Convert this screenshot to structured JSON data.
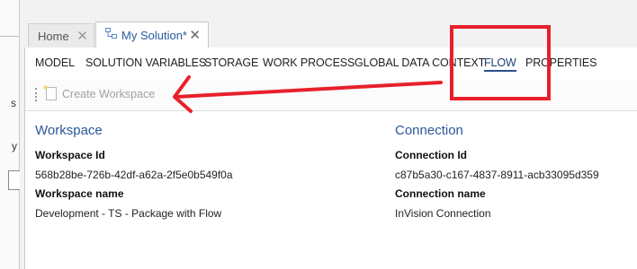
{
  "left_panel": {
    "char1": "s",
    "char2": "y"
  },
  "tabs": [
    {
      "label": "Home",
      "close": "✕"
    },
    {
      "label": "My Solution*",
      "close": "✕"
    }
  ],
  "menu": {
    "items": [
      {
        "label": "MODEL"
      },
      {
        "label": "SOLUTION VARIABLES"
      },
      {
        "label": "STORAGE"
      },
      {
        "label": "WORK PROCESS"
      },
      {
        "label": "GLOBAL DATA CONTEXT"
      },
      {
        "label": "FLOW",
        "active": true
      },
      {
        "label": "PROPERTIES"
      }
    ]
  },
  "toolbar": {
    "create_workspace": "Create Workspace"
  },
  "workspace": {
    "title": "Workspace",
    "id_label": "Workspace Id",
    "id_value": "568b28be-726b-42df-a62a-2f5e0b549f0a",
    "name_label": "Workspace name",
    "name_value": "Development - TS - Package with Flow"
  },
  "connection": {
    "title": "Connection",
    "id_label": "Connection Id",
    "id_value": "c87b5a30-c167-4837-8911-acb33095d359",
    "name_label": "Connection name",
    "name_value": "InVision Connection"
  },
  "colors": {
    "accent": "#2b5797",
    "annotation": "#e8202a"
  },
  "icons": {
    "tab_solution": "solution-hierarchy-icon",
    "create_workspace": "new-document-icon"
  }
}
